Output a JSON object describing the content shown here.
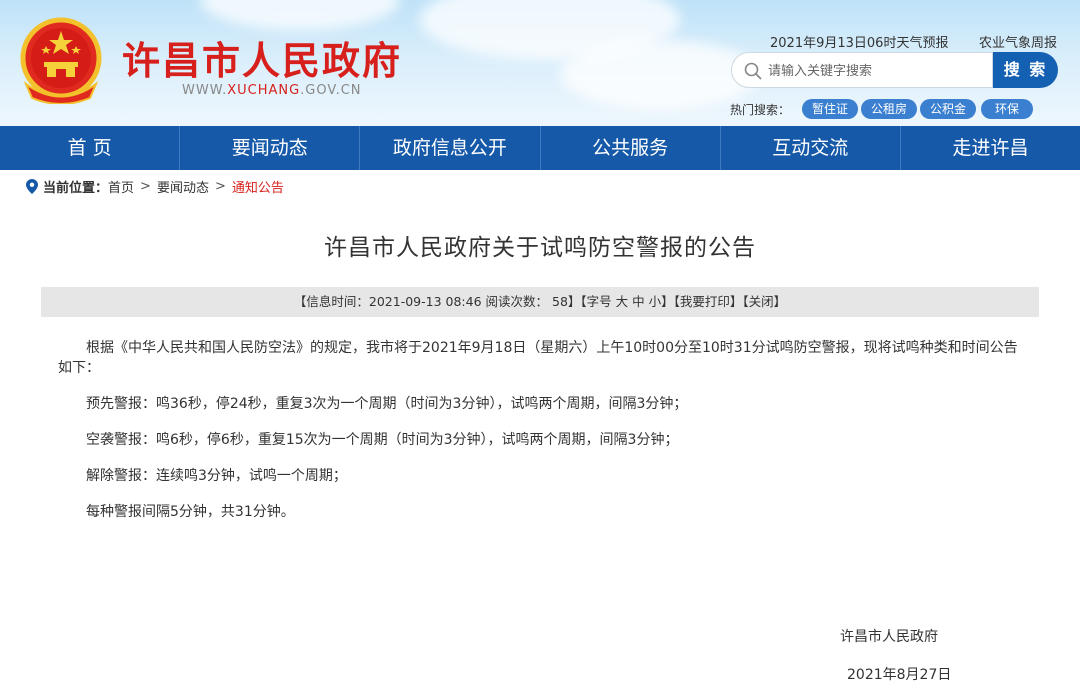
{
  "header": {
    "site_title": "许昌市人民政府",
    "site_url_prefix": "WWW.",
    "site_url_main": "XUCHANG",
    "site_url_suffix": ".GOV.CN",
    "weather": "2021年9月13日06时天气预报",
    "agri_weather": "农业气象周报",
    "search_placeholder": "请输入关键字搜索",
    "search_button": "搜 索",
    "hot_label": "热门搜索：",
    "hot_tags": [
      "暂住证",
      "公租房",
      "公积金",
      "环保"
    ]
  },
  "nav": [
    "首 页",
    "要闻动态",
    "政府信息公开",
    "公共服务",
    "互动交流",
    "走进许昌"
  ],
  "breadcrumb": {
    "label": "当前位置：",
    "items": [
      "首页",
      "要闻动态",
      "通知公告"
    ],
    "sep": ">"
  },
  "article": {
    "title": "许昌市人民政府关于试鸣防空警报的公告",
    "meta": "【信息时间：2021-09-13 08:46  阅读次数： 58】【字号 大 中 小】【我要打印】【关闭】",
    "paragraphs": [
      "根据《中华人民共和国人民防空法》的规定，我市将于2021年9月18日（星期六）上午10时00分至10时31分试鸣防空警报，现将试鸣种类和时间公告如下：",
      "预先警报：鸣36秒，停24秒，重复3次为一个周期（时间为3分钟），试鸣两个周期，间隔3分钟；",
      "空袭警报：鸣6秒，停6秒，重复15次为一个周期（时间为3分钟），试鸣两个周期，间隔3分钟；",
      "解除警报：连续鸣3分钟，试鸣一个周期；",
      "每种警报间隔5分钟，共31分钟。"
    ],
    "signature": "许昌市人民政府",
    "date": "2021年8月27日"
  },
  "colors": {
    "nav_bg": "#1559a8",
    "title_red": "#d7201c",
    "search_btn": "#1461b4",
    "tag_bg": "#3b7fd0"
  }
}
